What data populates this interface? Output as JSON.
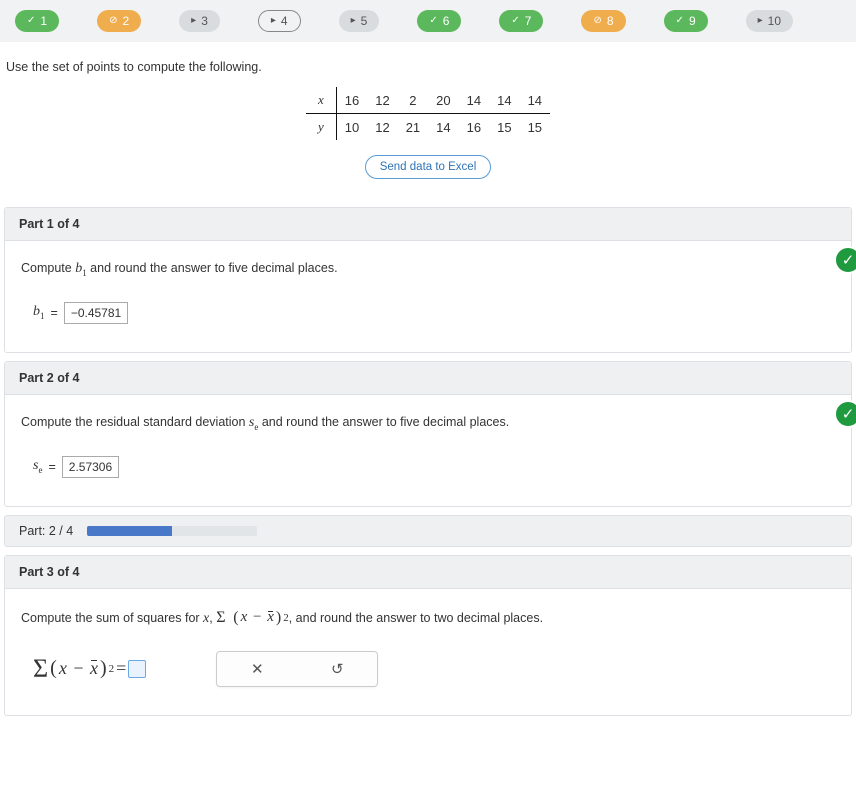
{
  "nav": [
    {
      "num": "1",
      "icon": "✓",
      "cls": "pill-green"
    },
    {
      "num": "2",
      "icon": "⊘",
      "cls": "pill-yellow"
    },
    {
      "num": "3",
      "icon": "▸",
      "cls": "pill-gray"
    },
    {
      "num": "4",
      "icon": "▸",
      "cls": "pill-outline"
    },
    {
      "num": "5",
      "icon": "▸",
      "cls": "pill-gray"
    },
    {
      "num": "6",
      "icon": "✓",
      "cls": "pill-green"
    },
    {
      "num": "7",
      "icon": "✓",
      "cls": "pill-green"
    },
    {
      "num": "8",
      "icon": "⊘",
      "cls": "pill-yellow"
    },
    {
      "num": "9",
      "icon": "✓",
      "cls": "pill-green"
    },
    {
      "num": "10",
      "icon": "▸",
      "cls": "pill-gray"
    }
  ],
  "prompt": "Use the set of points to compute the following.",
  "table": {
    "row_x_label": "x",
    "row_y_label": "y",
    "x": [
      "16",
      "12",
      "2",
      "20",
      "14",
      "14",
      "14"
    ],
    "y": [
      "10",
      "12",
      "21",
      "14",
      "16",
      "15",
      "15"
    ]
  },
  "excel_btn": "Send data to Excel",
  "part1": {
    "header": "Part 1 of 4",
    "instr_a": "Compute ",
    "instr_var": "b",
    "instr_sub": "1",
    "instr_b": " and round the answer to five decimal places.",
    "label_var": "b",
    "label_sub": "1",
    "eq": " = ",
    "value": "−0.45781"
  },
  "part2": {
    "header": "Part 2 of 4",
    "instr_a": "Compute the residual standard deviation ",
    "instr_var": "s",
    "instr_sub": "e",
    "instr_b": " and round the answer to five decimal places.",
    "label_var": "s",
    "label_sub": "e",
    "eq": " = ",
    "value": "2.57306"
  },
  "progress": {
    "label": "Part: 2 / 4",
    "pct": 50
  },
  "part3": {
    "header": "Part 3 of 4",
    "instr_a": "Compute the sum of squares for ",
    "instr_x": "x",
    "instr_comma": ", ",
    "instr_b": ", and round the answer to two decimal places.",
    "eq": " = ",
    "tools": {
      "clear": "✕",
      "reset": "↺"
    }
  }
}
